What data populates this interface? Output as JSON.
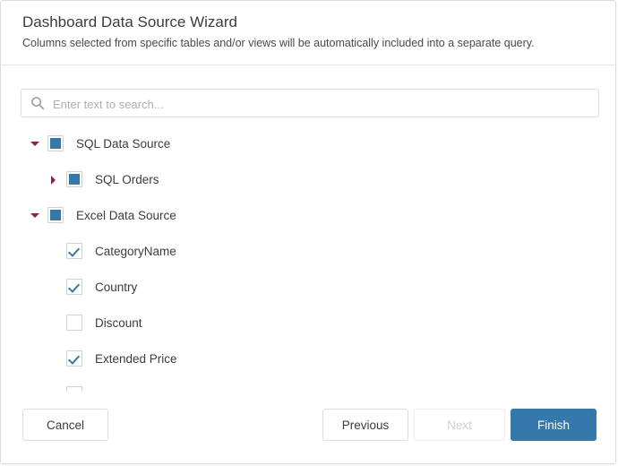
{
  "window": {
    "title": "Dashboard Data Source Wizard",
    "subtitle": "Columns selected from specific tables and/or views will be automatically included into a separate query."
  },
  "search": {
    "icon": "search-icon",
    "placeholder": "Enter text to search...",
    "value": ""
  },
  "tree": {
    "nodes": [
      {
        "label": "SQL Data Source",
        "level": 1,
        "expander": "expanded",
        "checkbox": "indeterminate"
      },
      {
        "label": "SQL Orders",
        "level": 2,
        "expander": "collapsed",
        "checkbox": "indeterminate"
      },
      {
        "label": "Excel Data Source",
        "level": 1,
        "expander": "expanded",
        "checkbox": "indeterminate"
      },
      {
        "label": "CategoryName",
        "level": 2,
        "expander": "none",
        "checkbox": "checked"
      },
      {
        "label": "Country",
        "level": 2,
        "expander": "none",
        "checkbox": "checked"
      },
      {
        "label": "Discount",
        "level": 2,
        "expander": "none",
        "checkbox": "unchecked"
      },
      {
        "label": "Extended Price",
        "level": 2,
        "expander": "none",
        "checkbox": "checked"
      },
      {
        "label": "",
        "level": 2,
        "expander": "none",
        "checkbox": "unchecked"
      }
    ]
  },
  "footer": {
    "cancel_label": "Cancel",
    "previous_label": "Previous",
    "next_label": "Next",
    "next_disabled": true,
    "finish_label": "Finish"
  },
  "colors": {
    "accent": "#3478ac",
    "expander": "#8c1f4f",
    "border": "#dcdcdc",
    "text": "#3c3c3c",
    "placeholder": "#aeaeae",
    "disabled_text": "#cfcfcf"
  }
}
